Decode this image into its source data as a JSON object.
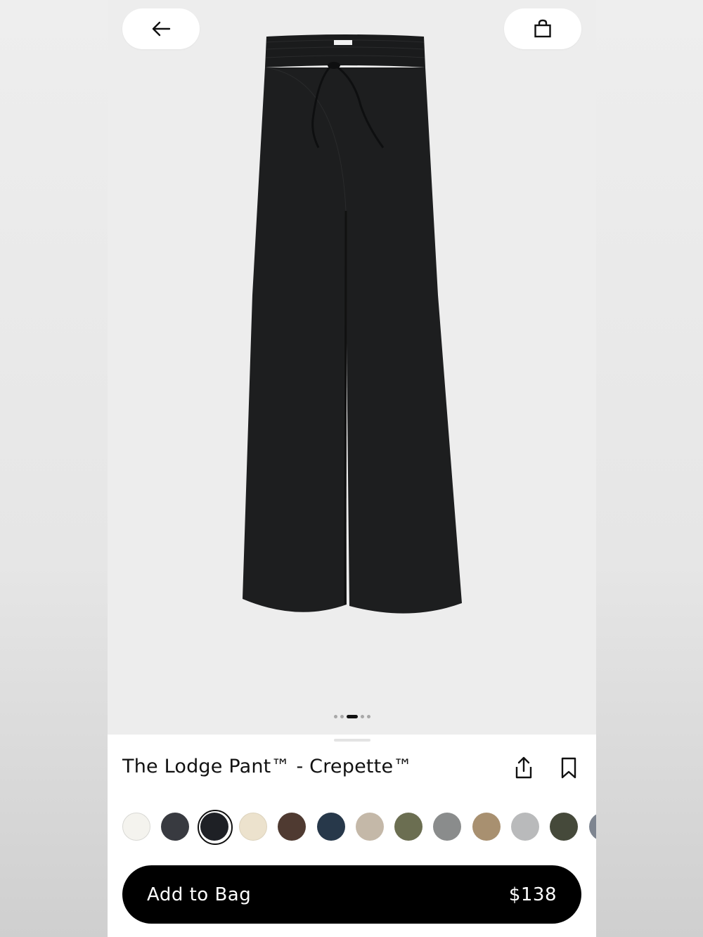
{
  "product": {
    "title": "The Lodge Pant™ - Crepette™",
    "price": "$138"
  },
  "actions": {
    "add_to_bag": "Add to Bag"
  },
  "icons": {
    "back": "arrow-left-icon",
    "bag": "shopping-bag-icon",
    "share": "share-icon",
    "save": "bookmark-icon"
  },
  "gallery": {
    "image_count": 5,
    "active_index": 2
  },
  "swatches": [
    {
      "color": "#f4f3ee",
      "selected": false
    },
    {
      "color": "#383a40",
      "selected": false
    },
    {
      "color": "#1e2025",
      "selected": true
    },
    {
      "color": "#ece2cd",
      "selected": false
    },
    {
      "color": "#4f3a31",
      "selected": false
    },
    {
      "color": "#27384a",
      "selected": false
    },
    {
      "color": "#c4b8a8",
      "selected": false
    },
    {
      "color": "#6b6e51",
      "selected": false
    },
    {
      "color": "#8a8c8c",
      "selected": false
    },
    {
      "color": "#a89070",
      "selected": false
    },
    {
      "color": "#b9babb",
      "selected": false
    },
    {
      "color": "#45493a",
      "selected": false
    },
    {
      "color": "#7e8590",
      "selected": false
    }
  ]
}
